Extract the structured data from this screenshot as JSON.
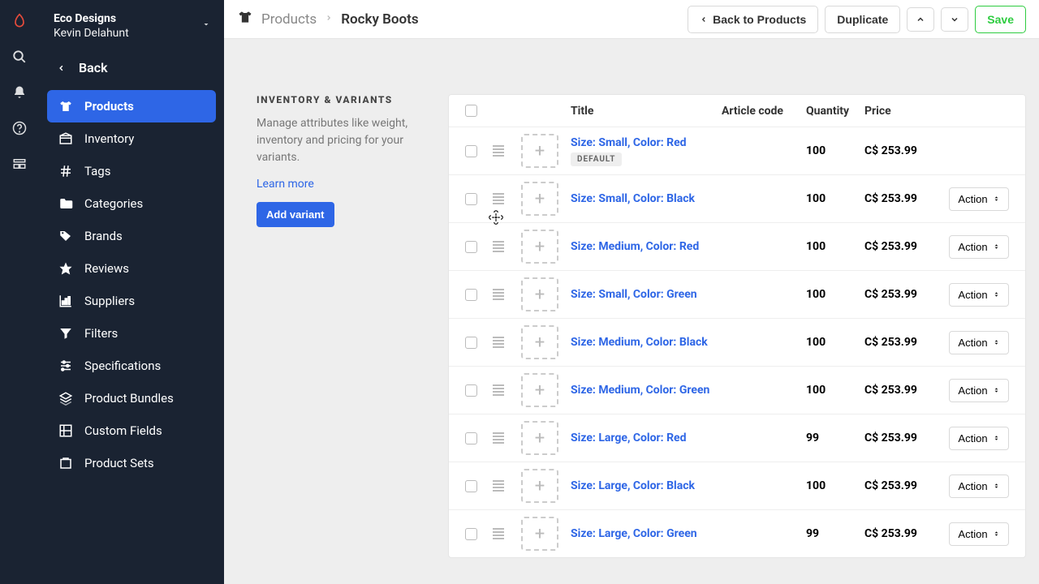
{
  "store": {
    "name": "Eco Designs",
    "user": "Kevin Delahunt"
  },
  "sidebar": {
    "back": "Back",
    "items": [
      {
        "label": "Products",
        "icon": "tshirt",
        "active": true
      },
      {
        "label": "Inventory",
        "icon": "box"
      },
      {
        "label": "Tags",
        "icon": "hash"
      },
      {
        "label": "Categories",
        "icon": "folder"
      },
      {
        "label": "Brands",
        "icon": "tag"
      },
      {
        "label": "Reviews",
        "icon": "star"
      },
      {
        "label": "Suppliers",
        "icon": "chart"
      },
      {
        "label": "Filters",
        "icon": "funnel"
      },
      {
        "label": "Specifications",
        "icon": "sliders"
      },
      {
        "label": "Product Bundles",
        "icon": "stack"
      },
      {
        "label": "Custom Fields",
        "icon": "grid"
      },
      {
        "label": "Product Sets",
        "icon": "collection"
      }
    ]
  },
  "breadcrumb": {
    "parent": "Products",
    "current": "Rocky Boots"
  },
  "topbar": {
    "back": "Back to Products",
    "duplicate": "Duplicate",
    "save": "Save"
  },
  "panel": {
    "title": "INVENTORY & VARIANTS",
    "desc": "Manage attributes like weight, inventory and pricing for your variants.",
    "learn": "Learn more",
    "add": "Add variant"
  },
  "table": {
    "headers": {
      "title": "Title",
      "article": "Article code",
      "qty": "Quantity",
      "price": "Price"
    },
    "action_label": "Action",
    "default_badge": "DEFAULT",
    "rows": [
      {
        "title": "Size: Small, Color: Red",
        "qty": "100",
        "price": "C$ 253.99",
        "default": true
      },
      {
        "title": "Size: Small, Color: Black",
        "qty": "100",
        "price": "C$ 253.99"
      },
      {
        "title": "Size: Medium, Color: Red",
        "qty": "100",
        "price": "C$ 253.99"
      },
      {
        "title": "Size: Small, Color: Green",
        "qty": "100",
        "price": "C$ 253.99"
      },
      {
        "title": "Size: Medium, Color: Black",
        "qty": "100",
        "price": "C$ 253.99"
      },
      {
        "title": "Size: Medium, Color: Green",
        "qty": "100",
        "price": "C$ 253.99"
      },
      {
        "title": "Size: Large, Color: Red",
        "qty": "99",
        "price": "C$ 253.99"
      },
      {
        "title": "Size: Large, Color: Black",
        "qty": "100",
        "price": "C$ 253.99"
      },
      {
        "title": "Size: Large, Color: Green",
        "qty": "99",
        "price": "C$ 253.99"
      }
    ]
  }
}
